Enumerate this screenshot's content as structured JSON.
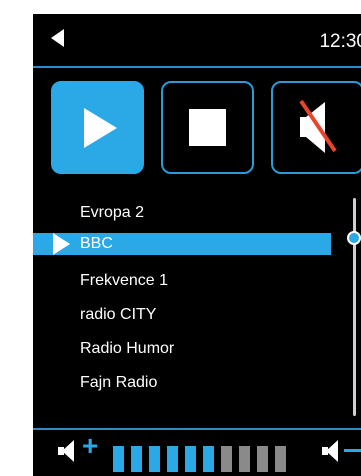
{
  "header": {
    "time": "12:30"
  },
  "controls": {
    "play": "play",
    "stop": "stop",
    "mute": "mute"
  },
  "stations": [
    {
      "label": "Evropa 2",
      "selected": false
    },
    {
      "label": "BBC",
      "selected": true
    },
    {
      "label": "Frekvence 1",
      "selected": false
    },
    {
      "label": "radio CITY",
      "selected": false
    },
    {
      "label": "Radio Humor",
      "selected": false
    },
    {
      "label": "Fajn Radio",
      "selected": false
    }
  ],
  "volume": {
    "segments_total": 10,
    "segments_on": 6
  },
  "colors": {
    "accent": "#2ba8e6",
    "background": "#000000",
    "segment_off": "#8a8a8a"
  },
  "icons": [
    "back-icon",
    "play-icon",
    "stop-icon",
    "mute-icon",
    "volume-up-icon",
    "volume-down-icon"
  ]
}
